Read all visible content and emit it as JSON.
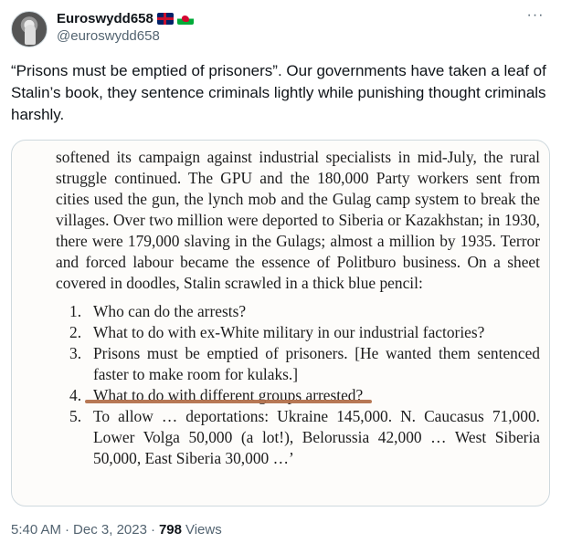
{
  "user": {
    "display_name": "Euroswydd658",
    "handle": "@euroswydd658",
    "flags": [
      "uk-flag-icon",
      "wales-flag-icon"
    ]
  },
  "tweet": {
    "text": "“Prisons must be emptied of prisoners”. Our governments have taken a leaf of Stalin’s book, they sentence criminals lightly while punishing thought criminals harshly."
  },
  "book_page": {
    "paragraph": "softened its campaign against industrial specialists in mid-July, the rural struggle continued. The GPU and the 180,000 Party workers sent from cities used the gun, the lynch mob and the Gulag camp system to break the villages. Over two million were deported to Siberia or Kazakhstan; in 1930, there were 179,000 slaving in the Gulags; almost a million by 1935. Terror and forced labour became the essence of Politburo business. On a sheet covered in doodles, Stalin scrawled in a thick blue pencil:",
    "items": [
      {
        "num": "1.",
        "text": "Who can do the arrests?"
      },
      {
        "num": "2.",
        "text": "What to do with ex-White military in our industrial factories?"
      },
      {
        "num": "3.",
        "text": "Prisons must be emptied of prisoners. [He wanted them sentenced faster to make room for kulaks.]"
      },
      {
        "num": "4.",
        "text": "What to do with different groups arrested?"
      },
      {
        "num": "5.",
        "text": "To allow … deportations: Ukraine 145,000. N. Caucasus 71,000. Lower Volga 50,000 (a lot!), Belorussia 42,000 … West Siberia 50,000, East Siberia 30,000 …’"
      }
    ],
    "highlight_color": "#b3714c"
  },
  "meta": {
    "time": "5:40 AM",
    "sep1": "·",
    "date": "Dec 3, 2023",
    "sep2": "·",
    "views_count": "798",
    "views_label": "Views"
  },
  "colors": {
    "text": "#0f1419",
    "secondary": "#536471",
    "border": "#cfd9de"
  }
}
